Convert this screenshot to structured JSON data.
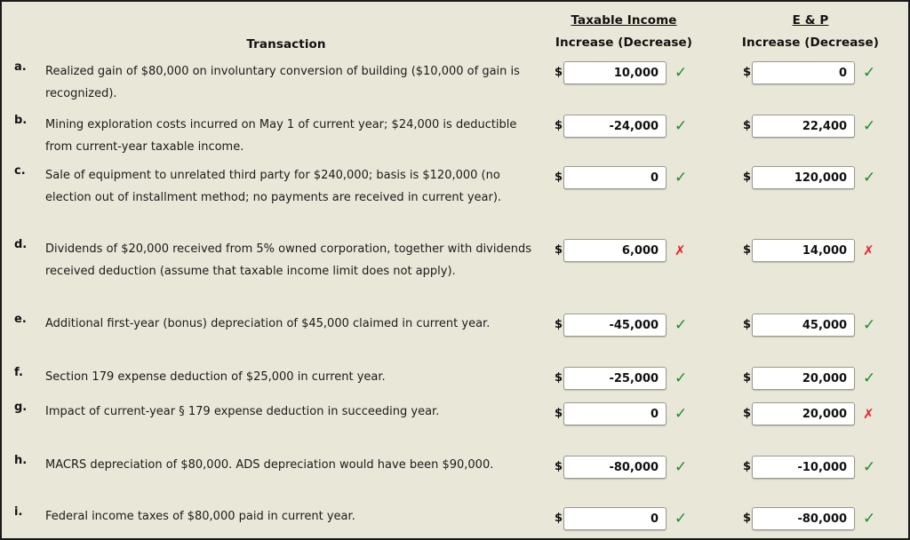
{
  "header": {
    "transaction_label": "Transaction",
    "taxable_income_title": "Taxable Income",
    "taxable_income_sub": "Increase (Decrease)",
    "ep_title": "E & P",
    "ep_sub": "Increase (Decrease)"
  },
  "currency_symbol": "$",
  "colors": {
    "background": "#e9e7d7",
    "border": "#1a1a1a",
    "correct": "#1f8a2b",
    "incorrect": "#ee1b2e",
    "field_background": "#ffffff"
  },
  "marks": {
    "correct_glyph": "✓",
    "incorrect_glyph": "✗"
  },
  "rows": [
    {
      "letter": "a.",
      "text": "Realized gain of $80,000 on involuntary conversion of building ($10,000 of gain is recognized).",
      "taxable_income": {
        "value": "10,000",
        "status": "correct"
      },
      "ep": {
        "value": "0",
        "status": "correct"
      }
    },
    {
      "letter": "b.",
      "text": "Mining exploration costs incurred on May 1 of current year; $24,000 is deductible from current-year taxable income.",
      "taxable_income": {
        "value": "-24,000",
        "status": "correct"
      },
      "ep": {
        "value": "22,400",
        "status": "correct"
      }
    },
    {
      "letter": "c.",
      "text": "Sale of equipment to unrelated third party for $240,000; basis is $120,000 (no election out of installment method; no payments are received in current year).",
      "taxable_income": {
        "value": "0",
        "status": "correct"
      },
      "ep": {
        "value": "120,000",
        "status": "correct"
      }
    },
    {
      "letter": "d.",
      "text": "Dividends of $20,000 received from 5% owned corporation, together with dividends received deduction (assume that taxable income limit does not apply).",
      "taxable_income": {
        "value": "6,000",
        "status": "incorrect"
      },
      "ep": {
        "value": "14,000",
        "status": "incorrect"
      }
    },
    {
      "letter": "e.",
      "text": "Additional first-year (bonus) depreciation of $45,000 claimed in current year.",
      "taxable_income": {
        "value": "-45,000",
        "status": "correct"
      },
      "ep": {
        "value": "45,000",
        "status": "correct"
      }
    },
    {
      "letter": "f.",
      "text": "Section 179 expense deduction of $25,000 in current year.",
      "taxable_income": {
        "value": "-25,000",
        "status": "correct"
      },
      "ep": {
        "value": "20,000",
        "status": "correct"
      }
    },
    {
      "letter": "g.",
      "text": "Impact of current-year § 179 expense deduction in succeeding year.",
      "taxable_income": {
        "value": "0",
        "status": "correct"
      },
      "ep": {
        "value": "20,000",
        "status": "incorrect"
      }
    },
    {
      "letter": "h.",
      "text": "MACRS depreciation of $80,000. ADS depreciation would have been $90,000.",
      "taxable_income": {
        "value": "-80,000",
        "status": "correct"
      },
      "ep": {
        "value": "-10,000",
        "status": "correct"
      }
    },
    {
      "letter": "i.",
      "text": "Federal income taxes of $80,000 paid in current year.",
      "taxable_income": {
        "value": "0",
        "status": "correct"
      },
      "ep": {
        "value": "-80,000",
        "status": "correct"
      }
    }
  ]
}
